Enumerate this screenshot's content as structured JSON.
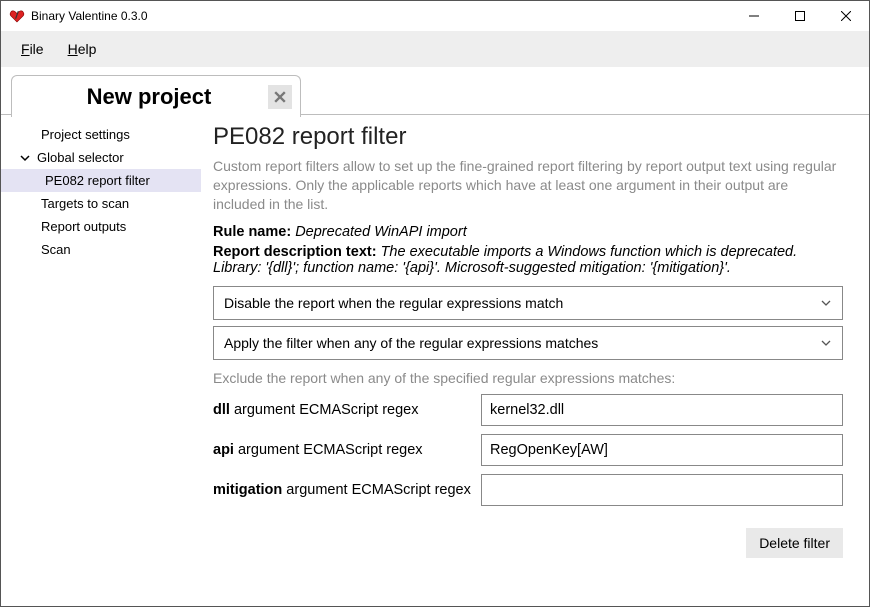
{
  "window": {
    "title": "Binary Valentine 0.3.0"
  },
  "menu": {
    "file": "File",
    "help": "Help"
  },
  "tab": {
    "title": "New project"
  },
  "sidebar": {
    "project_settings": "Project settings",
    "global_selector": "Global selector",
    "filter_item": "PE082 report filter",
    "targets": "Targets to scan",
    "outputs": "Report outputs",
    "scan": "Scan"
  },
  "content": {
    "heading": "PE082 report filter",
    "description": "Custom report filters allow to set up the fine-grained report filtering by report output text using regular expressions. Only the applicable reports which have at least one argument in their output are included in the list.",
    "rule_label": "Rule name:",
    "rule_value": "Deprecated WinAPI import",
    "desc_label": "Report description text:",
    "desc_value": "The executable imports a Windows function which is deprecated. Library: '{dll}'; function name: '{api}'. Microsoft-suggested mitigation: '{mitigation}'.",
    "select1": "Disable the report when the regular expressions match",
    "select2": "Apply the filter when any of the regular expressions matches",
    "hint": "Exclude the report when any of the specified regular expressions matches:",
    "rows": [
      {
        "bold": "dll",
        "rest": " argument ECMAScript regex",
        "value": "kernel32.dll"
      },
      {
        "bold": "api",
        "rest": " argument ECMAScript regex",
        "value": "RegOpenKey[AW]"
      },
      {
        "bold": "mitigation",
        "rest": " argument ECMAScript regex",
        "value": ""
      }
    ],
    "delete_btn": "Delete filter"
  }
}
